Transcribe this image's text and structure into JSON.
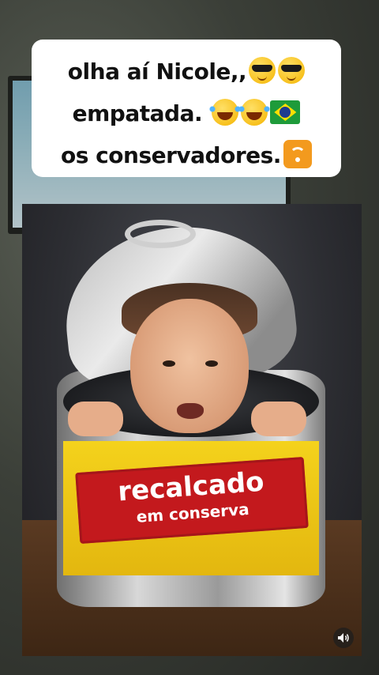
{
  "caption": {
    "line1_text": "olha aí Nicole,,",
    "line1_emojis": [
      "smiling-face-with-sunglasses",
      "smiling-face-with-sunglasses"
    ],
    "line2_text": "empatada.",
    "line2_emojis": [
      "face-with-tears-of-joy",
      "face-with-tears-of-joy",
      "flag-brazil"
    ],
    "line3_text": "os conservadores.",
    "line3_emojis": [
      "wireless-icon"
    ]
  },
  "photo": {
    "label_main": "recalcado",
    "label_sub": "em conserva"
  },
  "controls": {
    "sound_icon": "speaker-icon"
  }
}
